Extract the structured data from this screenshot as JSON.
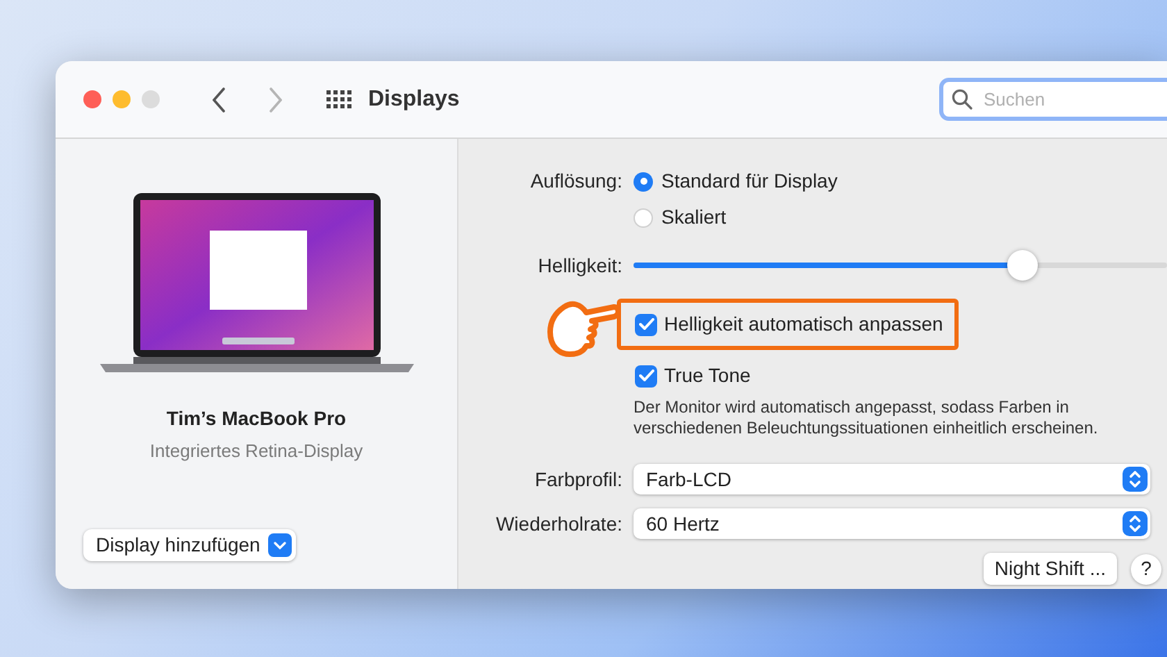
{
  "window": {
    "title": "Displays",
    "search": {
      "placeholder": "Suchen"
    }
  },
  "device": {
    "name": "Tim’s MacBook Pro",
    "subtitle": "Integriertes Retina-Display",
    "add_button": "Display hinzufügen"
  },
  "resolution": {
    "label": "Auflösung:",
    "options": [
      {
        "label": "Standard für Display",
        "selected": true
      },
      {
        "label": "Skaliert",
        "selected": false
      }
    ]
  },
  "brightness": {
    "label": "Helligkeit:",
    "level": 0.73
  },
  "checkboxes": [
    {
      "label": "Helligkeit automatisch anpassen",
      "checked": true,
      "highlighted": true
    },
    {
      "label": "True Tone",
      "checked": true,
      "highlighted": false,
      "description": "Der Monitor wird automatisch angepasst, sodass Farben in verschiedenen Beleuchtungssituationen einheitlich erscheinen."
    }
  ],
  "popups": [
    {
      "label": "Farbprofil:",
      "value": "Farb-LCD"
    },
    {
      "label": "Wiederholrate:",
      "value": "60 Hertz"
    }
  ],
  "buttons": {
    "night_shift": "Night Shift ...",
    "help": "?"
  }
}
